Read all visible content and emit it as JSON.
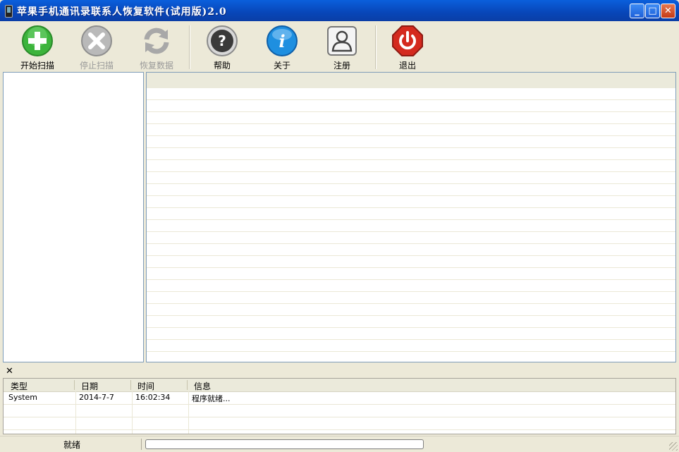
{
  "window": {
    "title": "苹果手机通讯录联系人恢复软件(试用版)2.0",
    "controls": {
      "minimize": "_",
      "maximize": "□",
      "close": "✕"
    }
  },
  "toolbar": {
    "start_scan": "开始扫描",
    "stop_scan": "停止扫描",
    "recover_data": "恢复数据",
    "help": "帮助",
    "about": "关于",
    "register": "注册",
    "exit": "退出"
  },
  "log": {
    "close_glyph": "✕",
    "columns": [
      "类型",
      "日期",
      "时间",
      "信息"
    ],
    "rows": [
      {
        "type": "System",
        "date": "2014-7-7",
        "time": "16:02:34",
        "message": "程序就绪..."
      }
    ]
  },
  "status": {
    "text": "就绪",
    "progress": 0
  },
  "colors": {
    "titlebar": "#0a5fdc",
    "window_bg": "#ece9d8",
    "add": "#3cb43c",
    "exit": "#d42a1e",
    "info": "#1e8fe0"
  }
}
